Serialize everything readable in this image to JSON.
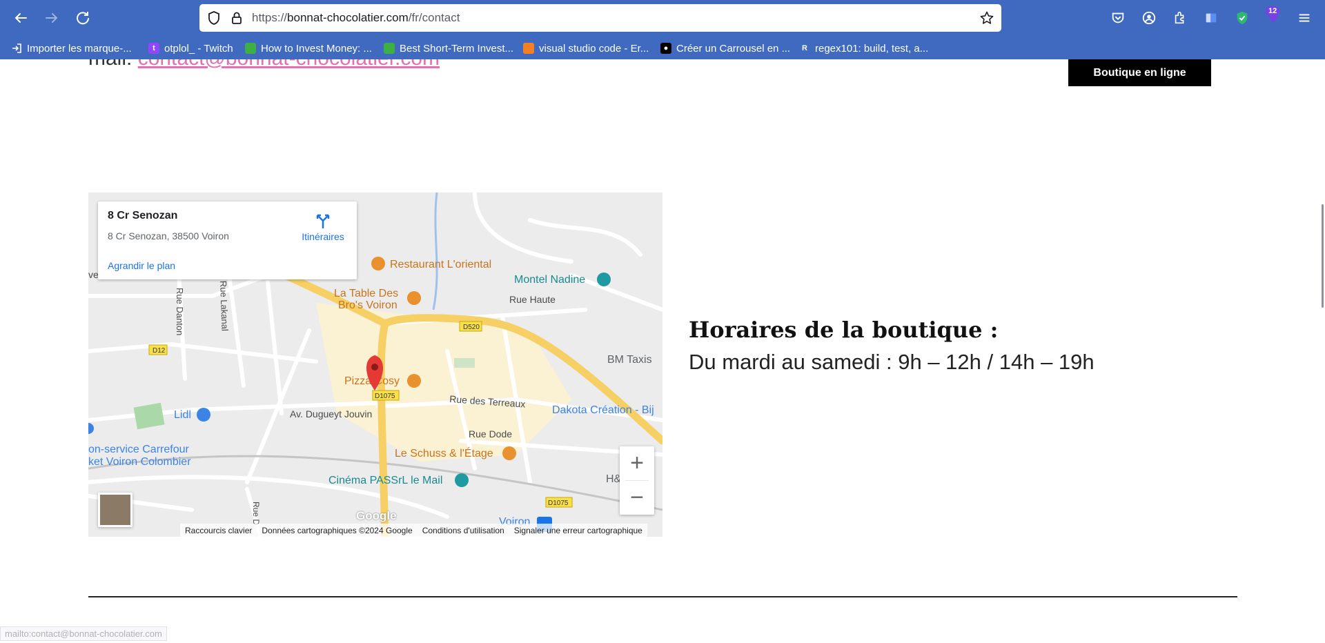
{
  "browser": {
    "url_scheme": "https://",
    "url_domain": "bonnat-chocolatier.com",
    "url_path": "/fr/contact",
    "extension_badge": "12",
    "bookmarks": [
      {
        "label": "Importer les marque-...",
        "icon": "import-icon"
      },
      {
        "label": "otplol_ - Twitch",
        "icon": "twitch-icon"
      },
      {
        "label": "How to Invest Money: ...",
        "icon": "bookmark-site-icon"
      },
      {
        "label": "Best Short-Term Invest...",
        "icon": "bookmark-site-icon"
      },
      {
        "label": "visual studio code - Er...",
        "icon": "stackoverflow-icon"
      },
      {
        "label": "Créer un Carrousel en ...",
        "icon": "medium-icon"
      },
      {
        "label": "regex101: build, test, a...",
        "icon": "regex-icon"
      }
    ]
  },
  "page": {
    "mail_prefix": "mail:",
    "mail_link": "contact@bonnat-chocolatier.com",
    "shop_button": "Boutique en ligne",
    "hours_title": "Horaires de la boutique :",
    "hours_text": "Du mardi au samedi : 9h – 12h / 14h – 19h",
    "status_url": "mailto:contact@bonnat-chocolatier.com"
  },
  "map": {
    "card_title": "8 Cr Senozan",
    "card_address": "8 Cr Senozan, 38500 Voiron",
    "directions_label": "Itinéraires",
    "enlarge_label": "Agrandir le plan",
    "zoom_in": "+",
    "zoom_out": "−",
    "google_logo": "Google",
    "attribution": {
      "shortcuts": "Raccourcis clavier",
      "data": "Données cartographiques ©2024 Google",
      "terms": "Conditions d'utilisation",
      "report": "Signaler une erreur cartographique"
    },
    "labels": {
      "restaurant_oriental": "Restaurant L'oriental",
      "montel_nadine": "Montel Nadine",
      "table_bros_1": "La Table Des",
      "table_bros_2": "Bro's Voiron",
      "rue_haute": "Rue Haute",
      "d520": "D520",
      "bm_taxis": "BM Taxis",
      "pizza_cosy": "Pizza Cosy",
      "d1075_a": "D1075",
      "rue_terreaux": "Rue des Terreaux",
      "dakota": "Dakota Création - Bij",
      "av_dugueyt": "Av. Dugueyt Jouvin",
      "rue_dode": "Rue Dode",
      "lidl": "Lidl",
      "carrefour_1": "on-service Carrefour",
      "carrefour_2": "ket Voiron Colombier",
      "le_schuss": "Le Schuss & l'Étage",
      "cinema": "Cinéma PASSrL le Mail",
      "d1075_b": "D1075",
      "voiron": "Voiron",
      "h_and": "H&",
      "rue_danton": "Rue Danton",
      "rue_lakanal": "Rue Lakanal",
      "d12": "D12",
      "rue_d": "Rue D",
      "ve": "ve"
    }
  },
  "colors": {
    "chrome": "#3f6abf",
    "link_pink": "#e46fb3",
    "road_major": "#f6cf65",
    "poi_food": "#e8912e",
    "poi_teal": "#1e9aa0",
    "poi_blue": "#3b84e6",
    "pin": "#e53935"
  }
}
